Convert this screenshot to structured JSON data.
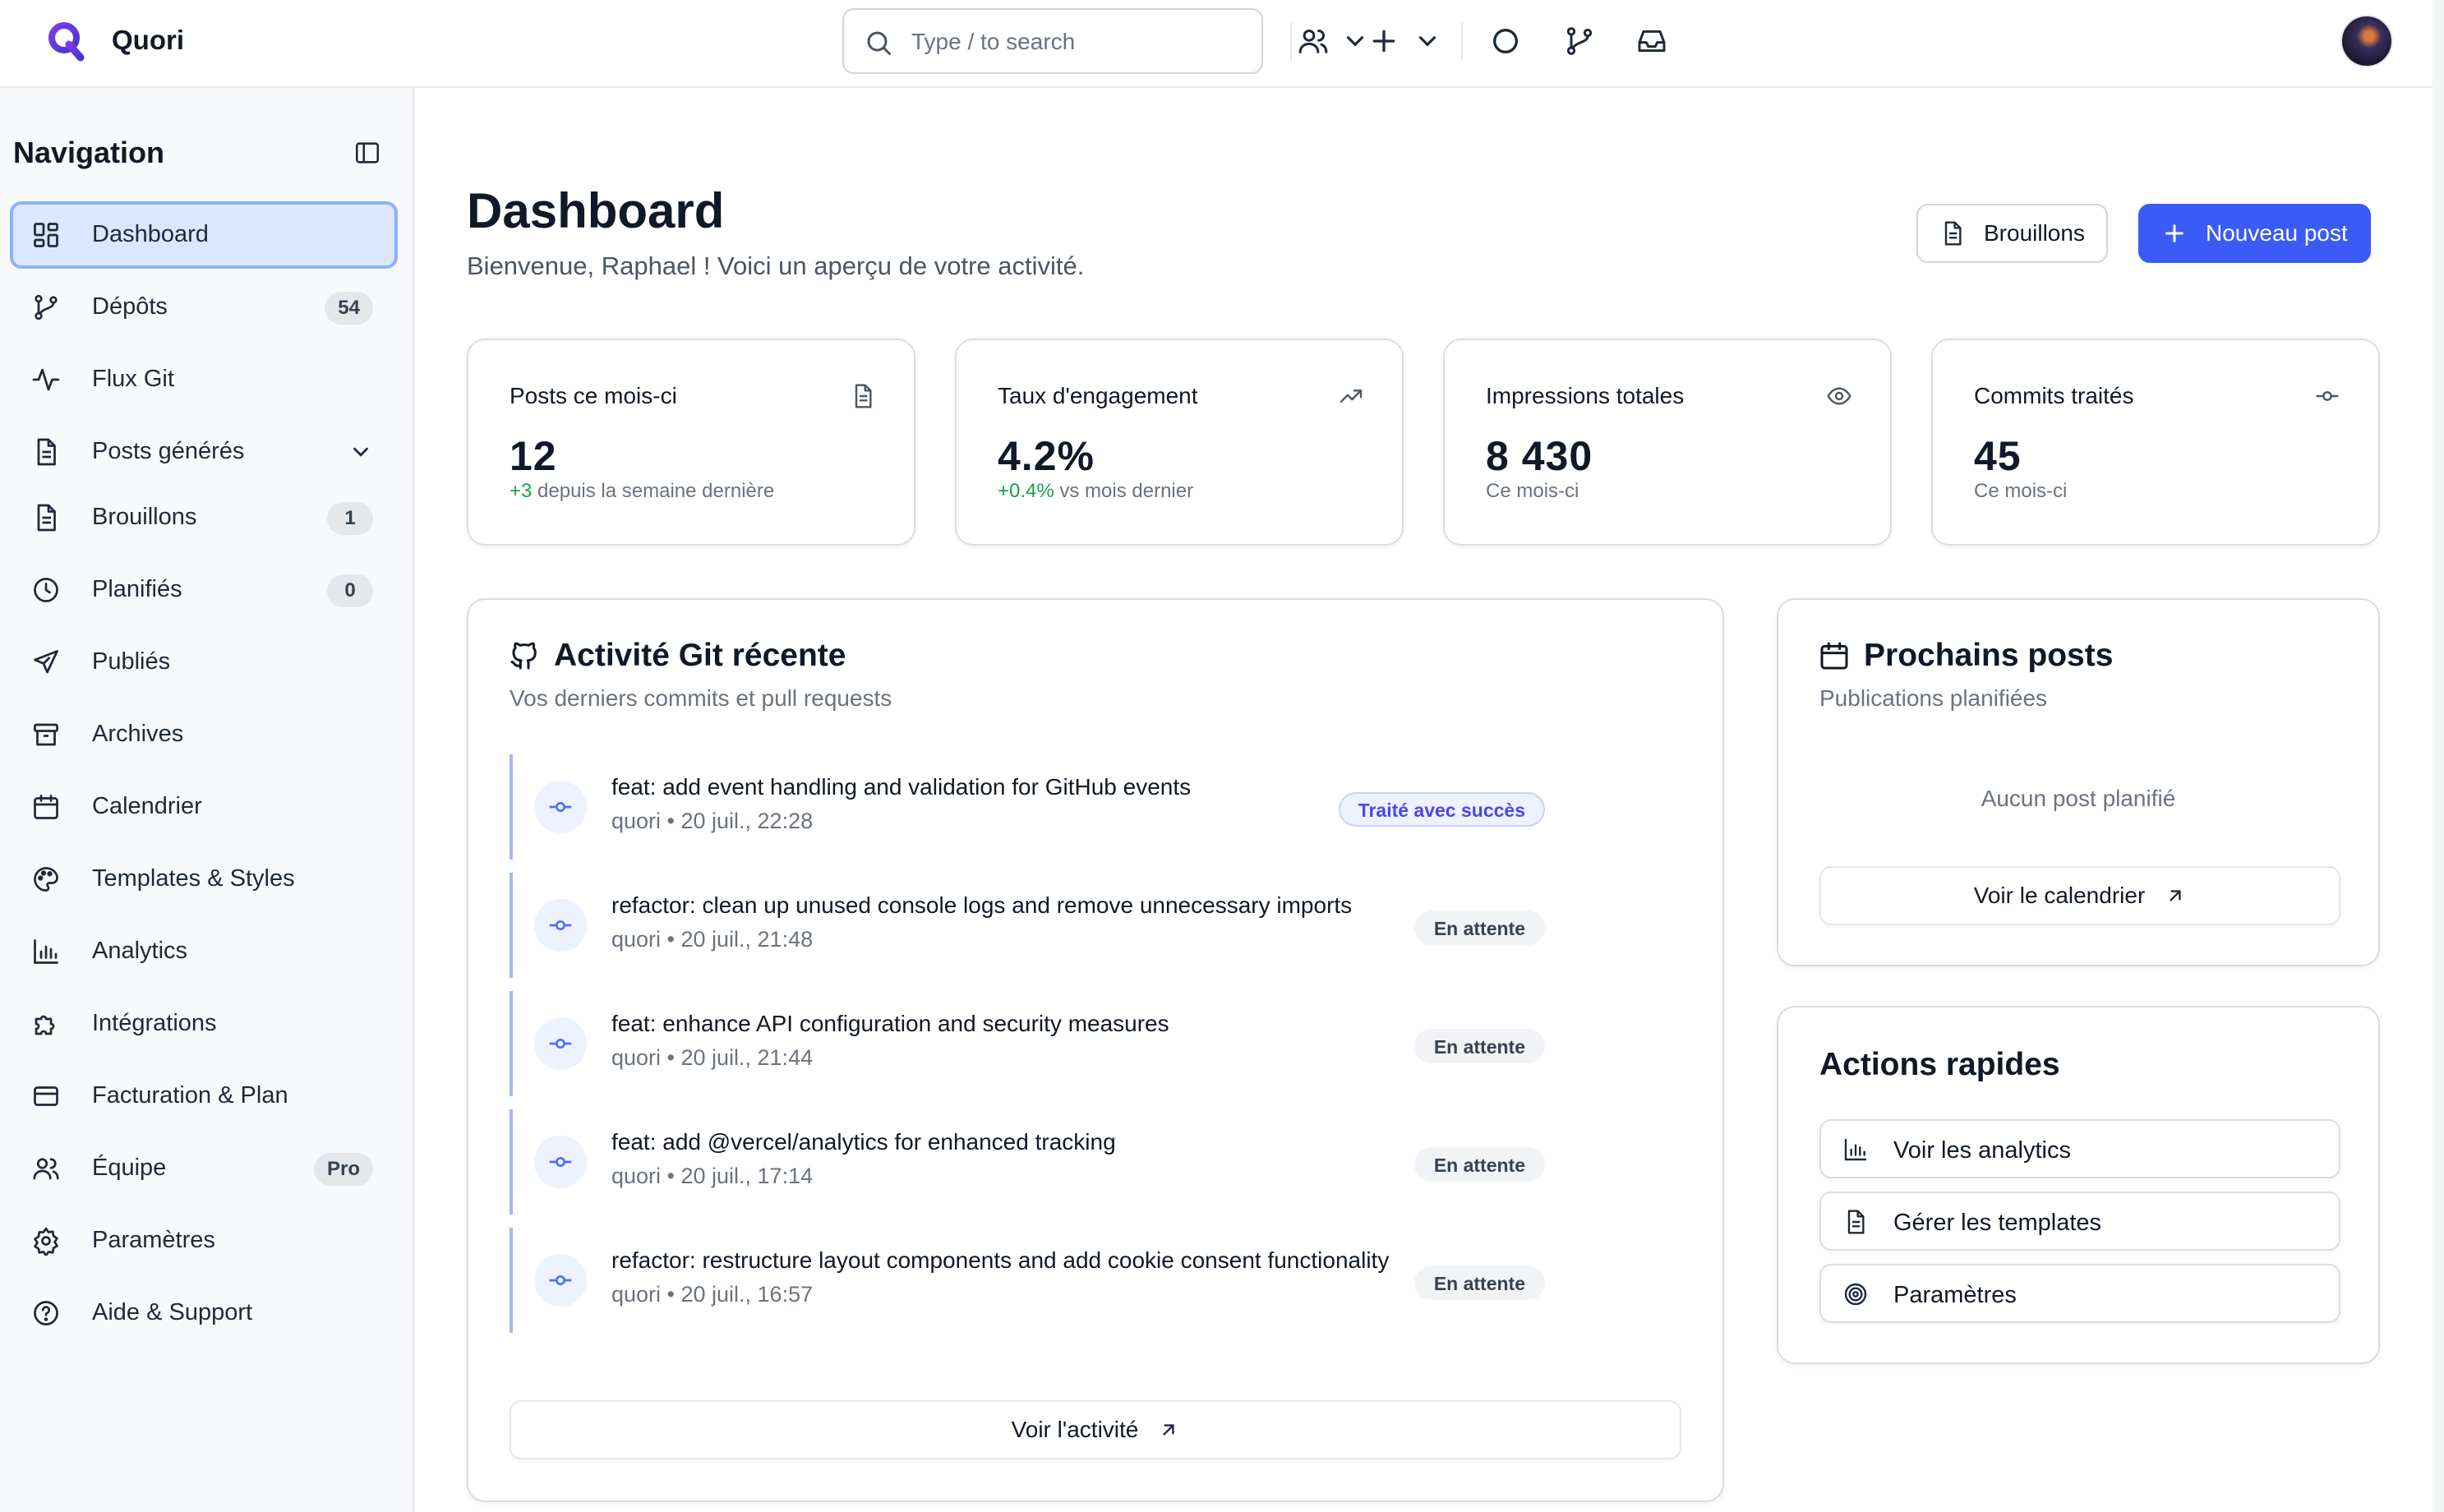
{
  "app": {
    "name": "Quori"
  },
  "topbar": {
    "search_placeholder": "Type / to search",
    "icons": [
      "search-icon",
      "users-icon",
      "chevron-down-icon",
      "plus-icon",
      "chevron-down-icon",
      "circle-icon",
      "git-branch-icon",
      "inbox-icon",
      "avatar"
    ]
  },
  "sidebar": {
    "title": "Navigation",
    "items": [
      {
        "label": "Dashboard",
        "icon": "dashboard-icon",
        "active": true
      },
      {
        "label": "Dépôts",
        "icon": "git-branch-icon",
        "badge": "54"
      },
      {
        "label": "Flux Git",
        "icon": "activity-icon"
      },
      {
        "label": "Posts générés",
        "icon": "file-icon"
      },
      {
        "label": "Brouillons",
        "icon": "file-text-icon",
        "badge": "1"
      },
      {
        "label": "Planifiés",
        "icon": "clock-icon",
        "badge": "0"
      },
      {
        "label": "Publiés",
        "icon": "send-icon"
      },
      {
        "label": "Archives",
        "icon": "archive-icon"
      },
      {
        "label": "Calendrier",
        "icon": "calendar-icon"
      },
      {
        "label": "Templates & Styles",
        "icon": "palette-icon"
      },
      {
        "label": "Analytics",
        "icon": "bar-chart-icon"
      },
      {
        "label": "Intégrations",
        "icon": "puzzle-icon"
      },
      {
        "label": "Facturation & Plan",
        "icon": "credit-card-icon"
      },
      {
        "label": "Équipe",
        "icon": "users-icon",
        "badge": "Pro"
      },
      {
        "label": "Paramètres",
        "icon": "gear-icon"
      },
      {
        "label": "Aide & Support",
        "icon": "help-icon"
      }
    ]
  },
  "header": {
    "title": "Dashboard",
    "subtitle": "Bienvenue, Raphael ! Voici un aperçu de votre activité.",
    "drafts_button": "Brouillons",
    "new_post_button": "Nouveau post"
  },
  "stats": [
    {
      "label": "Posts ce mois-ci",
      "value": "12",
      "delta": "+3",
      "note": " depuis la semaine dernière",
      "icon": "file-icon"
    },
    {
      "label": "Taux d'engagement",
      "value": "4.2%",
      "delta": "+0.4%",
      "note": " vs mois dernier",
      "icon": "trending-up-icon"
    },
    {
      "label": "Impressions totales",
      "value": "8 430",
      "delta": "",
      "note": "Ce mois-ci",
      "icon": "eye-icon"
    },
    {
      "label": "Commits traités",
      "value": "45",
      "delta": "",
      "note": "Ce mois-ci",
      "icon": "commit-icon"
    }
  ],
  "activity": {
    "title": "Activité Git récente",
    "subtitle": "Vos derniers commits et pull requests",
    "commits": [
      {
        "message": "feat: add event handling and validation for GitHub events",
        "meta": "quori • 20 juil., 22:28",
        "status": "Traité avec succès",
        "state": "ok"
      },
      {
        "message": "refactor: clean up unused console logs and remove unnecessary imports",
        "meta": "quori • 20 juil., 21:48",
        "status": "En attente",
        "state": "wait"
      },
      {
        "message": "feat: enhance API configuration and security measures",
        "meta": "quori • 20 juil., 21:44",
        "status": "En attente",
        "state": "wait"
      },
      {
        "message": "feat: add @vercel/analytics for enhanced tracking",
        "meta": "quori • 20 juil., 17:14",
        "status": "En attente",
        "state": "wait"
      },
      {
        "message": "refactor: restructure layout components and add cookie consent functionality",
        "meta": "quori • 20 juil., 16:57",
        "status": "En attente",
        "state": "wait"
      }
    ],
    "view_all": "Voir l'activité"
  },
  "upcoming": {
    "title": "Prochains posts",
    "subtitle": "Publications planifiées",
    "empty": "Aucun post planifié",
    "calendar_button": "Voir le calendrier"
  },
  "quick_actions": {
    "title": "Actions rapides",
    "items": [
      {
        "label": "Voir les analytics",
        "icon": "bar-chart-icon"
      },
      {
        "label": "Gérer les templates",
        "icon": "file-text-icon"
      },
      {
        "label": "Paramètres",
        "icon": "target-icon"
      }
    ]
  },
  "colors": {
    "primary": "#3b5bf5",
    "active_bg": "#dbe7ff",
    "success": "#16a34a",
    "badge_ok": "#4f46e5"
  }
}
